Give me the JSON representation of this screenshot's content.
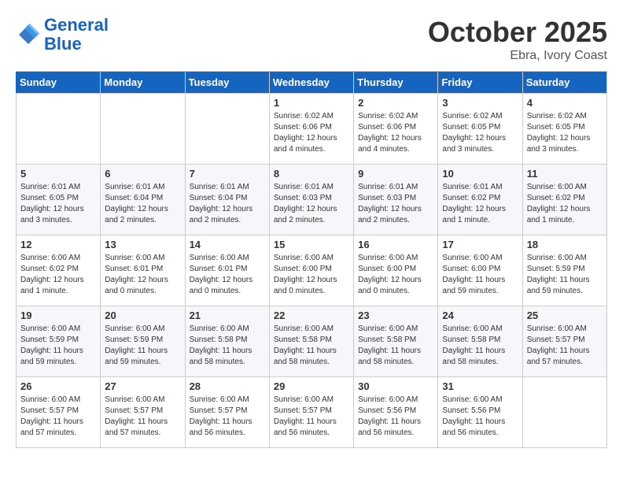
{
  "header": {
    "logo_line1": "General",
    "logo_line2": "Blue",
    "month": "October 2025",
    "location": "Ebra, Ivory Coast"
  },
  "days_of_week": [
    "Sunday",
    "Monday",
    "Tuesday",
    "Wednesday",
    "Thursday",
    "Friday",
    "Saturday"
  ],
  "weeks": [
    [
      {
        "day": "",
        "info": ""
      },
      {
        "day": "",
        "info": ""
      },
      {
        "day": "",
        "info": ""
      },
      {
        "day": "1",
        "info": "Sunrise: 6:02 AM\nSunset: 6:06 PM\nDaylight: 12 hours\nand 4 minutes."
      },
      {
        "day": "2",
        "info": "Sunrise: 6:02 AM\nSunset: 6:06 PM\nDaylight: 12 hours\nand 4 minutes."
      },
      {
        "day": "3",
        "info": "Sunrise: 6:02 AM\nSunset: 6:05 PM\nDaylight: 12 hours\nand 3 minutes."
      },
      {
        "day": "4",
        "info": "Sunrise: 6:02 AM\nSunset: 6:05 PM\nDaylight: 12 hours\nand 3 minutes."
      }
    ],
    [
      {
        "day": "5",
        "info": "Sunrise: 6:01 AM\nSunset: 6:05 PM\nDaylight: 12 hours\nand 3 minutes."
      },
      {
        "day": "6",
        "info": "Sunrise: 6:01 AM\nSunset: 6:04 PM\nDaylight: 12 hours\nand 2 minutes."
      },
      {
        "day": "7",
        "info": "Sunrise: 6:01 AM\nSunset: 6:04 PM\nDaylight: 12 hours\nand 2 minutes."
      },
      {
        "day": "8",
        "info": "Sunrise: 6:01 AM\nSunset: 6:03 PM\nDaylight: 12 hours\nand 2 minutes."
      },
      {
        "day": "9",
        "info": "Sunrise: 6:01 AM\nSunset: 6:03 PM\nDaylight: 12 hours\nand 2 minutes."
      },
      {
        "day": "10",
        "info": "Sunrise: 6:01 AM\nSunset: 6:02 PM\nDaylight: 12 hours\nand 1 minute."
      },
      {
        "day": "11",
        "info": "Sunrise: 6:00 AM\nSunset: 6:02 PM\nDaylight: 12 hours\nand 1 minute."
      }
    ],
    [
      {
        "day": "12",
        "info": "Sunrise: 6:00 AM\nSunset: 6:02 PM\nDaylight: 12 hours\nand 1 minute."
      },
      {
        "day": "13",
        "info": "Sunrise: 6:00 AM\nSunset: 6:01 PM\nDaylight: 12 hours\nand 0 minutes."
      },
      {
        "day": "14",
        "info": "Sunrise: 6:00 AM\nSunset: 6:01 PM\nDaylight: 12 hours\nand 0 minutes."
      },
      {
        "day": "15",
        "info": "Sunrise: 6:00 AM\nSunset: 6:00 PM\nDaylight: 12 hours\nand 0 minutes."
      },
      {
        "day": "16",
        "info": "Sunrise: 6:00 AM\nSunset: 6:00 PM\nDaylight: 12 hours\nand 0 minutes."
      },
      {
        "day": "17",
        "info": "Sunrise: 6:00 AM\nSunset: 6:00 PM\nDaylight: 11 hours\nand 59 minutes."
      },
      {
        "day": "18",
        "info": "Sunrise: 6:00 AM\nSunset: 5:59 PM\nDaylight: 11 hours\nand 59 minutes."
      }
    ],
    [
      {
        "day": "19",
        "info": "Sunrise: 6:00 AM\nSunset: 5:59 PM\nDaylight: 11 hours\nand 59 minutes."
      },
      {
        "day": "20",
        "info": "Sunrise: 6:00 AM\nSunset: 5:59 PM\nDaylight: 11 hours\nand 59 minutes."
      },
      {
        "day": "21",
        "info": "Sunrise: 6:00 AM\nSunset: 5:58 PM\nDaylight: 11 hours\nand 58 minutes."
      },
      {
        "day": "22",
        "info": "Sunrise: 6:00 AM\nSunset: 5:58 PM\nDaylight: 11 hours\nand 58 minutes."
      },
      {
        "day": "23",
        "info": "Sunrise: 6:00 AM\nSunset: 5:58 PM\nDaylight: 11 hours\nand 58 minutes."
      },
      {
        "day": "24",
        "info": "Sunrise: 6:00 AM\nSunset: 5:58 PM\nDaylight: 11 hours\nand 58 minutes."
      },
      {
        "day": "25",
        "info": "Sunrise: 6:00 AM\nSunset: 5:57 PM\nDaylight: 11 hours\nand 57 minutes."
      }
    ],
    [
      {
        "day": "26",
        "info": "Sunrise: 6:00 AM\nSunset: 5:57 PM\nDaylight: 11 hours\nand 57 minutes."
      },
      {
        "day": "27",
        "info": "Sunrise: 6:00 AM\nSunset: 5:57 PM\nDaylight: 11 hours\nand 57 minutes."
      },
      {
        "day": "28",
        "info": "Sunrise: 6:00 AM\nSunset: 5:57 PM\nDaylight: 11 hours\nand 56 minutes."
      },
      {
        "day": "29",
        "info": "Sunrise: 6:00 AM\nSunset: 5:57 PM\nDaylight: 11 hours\nand 56 minutes."
      },
      {
        "day": "30",
        "info": "Sunrise: 6:00 AM\nSunset: 5:56 PM\nDaylight: 11 hours\nand 56 minutes."
      },
      {
        "day": "31",
        "info": "Sunrise: 6:00 AM\nSunset: 5:56 PM\nDaylight: 11 hours\nand 56 minutes."
      },
      {
        "day": "",
        "info": ""
      }
    ]
  ]
}
